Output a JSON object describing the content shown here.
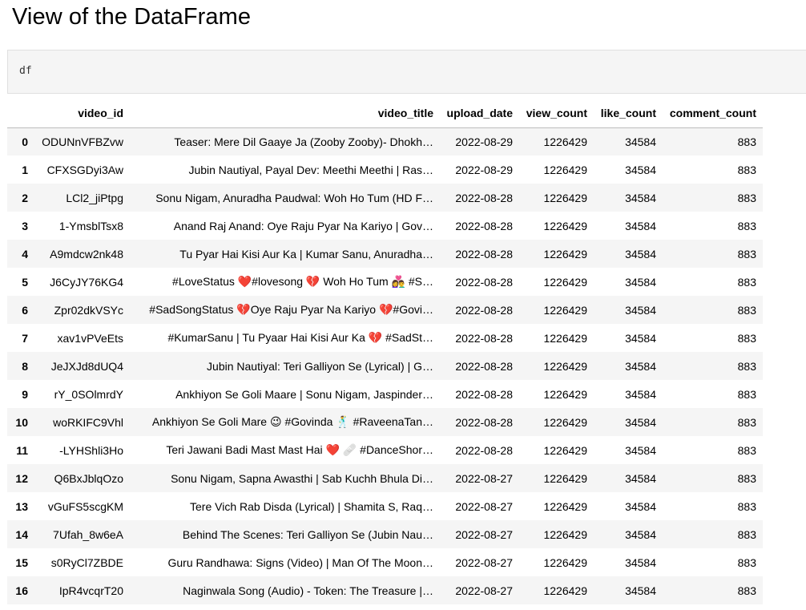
{
  "heading": "View of the DataFrame",
  "code": "df",
  "columns": [
    "",
    "video_id",
    "video_title",
    "upload_date",
    "view_count",
    "like_count",
    "comment_count"
  ],
  "rows": [
    {
      "idx": "0",
      "video_id": "ODUNnVFBZvw",
      "video_title": "Teaser: Mere Dil Gaaye Ja (Zooby Zooby)- Dhokh…",
      "upload_date": "2022-08-29",
      "view_count": "1226429",
      "like_count": "34584",
      "comment_count": "883"
    },
    {
      "idx": "1",
      "video_id": "CFXSGDyi3Aw",
      "video_title": "Jubin Nautiyal, Payal Dev: Meethi Meethi | Ras…",
      "upload_date": "2022-08-29",
      "view_count": "1226429",
      "like_count": "34584",
      "comment_count": "883"
    },
    {
      "idx": "2",
      "video_id": "LCl2_jiPtpg",
      "video_title": "Sonu Nigam, Anuradha Paudwal: Woh Ho Tum (HD F…",
      "upload_date": "2022-08-28",
      "view_count": "1226429",
      "like_count": "34584",
      "comment_count": "883"
    },
    {
      "idx": "3",
      "video_id": "1-YmsblTsx8",
      "video_title": "Anand Raj Anand: Oye Raju Pyar Na Kariyo | Gov…",
      "upload_date": "2022-08-28",
      "view_count": "1226429",
      "like_count": "34584",
      "comment_count": "883"
    },
    {
      "idx": "4",
      "video_id": "A9mdcw2nk48",
      "video_title": "Tu Pyar Hai Kisi Aur Ka | Kumar Sanu, Anuradha…",
      "upload_date": "2022-08-28",
      "view_count": "1226429",
      "like_count": "34584",
      "comment_count": "883"
    },
    {
      "idx": "5",
      "video_id": "J6CyJY76KG4",
      "video_title": "#LoveStatus ❤️#lovesong 💔 Woh Ho Tum 👩‍❤️‍👨 #S…",
      "upload_date": "2022-08-28",
      "view_count": "1226429",
      "like_count": "34584",
      "comment_count": "883"
    },
    {
      "idx": "6",
      "video_id": "Zpr02dkVSYc",
      "video_title": "#SadSongStatus 💔Oye Raju Pyar Na Kariyo 💔#Govi…",
      "upload_date": "2022-08-28",
      "view_count": "1226429",
      "like_count": "34584",
      "comment_count": "883"
    },
    {
      "idx": "7",
      "video_id": "xav1vPVeEts",
      "video_title": "#KumarSanu | Tu Pyaar Hai Kisi Aur Ka 💔 #SadSt…",
      "upload_date": "2022-08-28",
      "view_count": "1226429",
      "like_count": "34584",
      "comment_count": "883"
    },
    {
      "idx": "8",
      "video_id": "JeJXJd8dUQ4",
      "video_title": "Jubin Nautiyal: Teri Galliyon Se (Lyrical) | G…",
      "upload_date": "2022-08-28",
      "view_count": "1226429",
      "like_count": "34584",
      "comment_count": "883"
    },
    {
      "idx": "9",
      "video_id": "rY_0SOlmrdY",
      "video_title": "Ankhiyon Se Goli Maare | Sonu Nigam, Jaspinder…",
      "upload_date": "2022-08-28",
      "view_count": "1226429",
      "like_count": "34584",
      "comment_count": "883"
    },
    {
      "idx": "10",
      "video_id": "woRKIFC9Vhl",
      "video_title": "Ankhiyon Se Goli Mare 😉 #Govinda 🕺 #RaveenaTan…",
      "upload_date": "2022-08-28",
      "view_count": "1226429",
      "like_count": "34584",
      "comment_count": "883"
    },
    {
      "idx": "11",
      "video_id": "-LYHShli3Ho",
      "video_title": "Teri Jawani Badi Mast Mast Hai ❤️ 🩹 #DanceShor…",
      "upload_date": "2022-08-28",
      "view_count": "1226429",
      "like_count": "34584",
      "comment_count": "883"
    },
    {
      "idx": "12",
      "video_id": "Q6BxJblqOzo",
      "video_title": "Sonu Nigam, Sapna Awasthi | Sab Kuchh Bhula Di…",
      "upload_date": "2022-08-27",
      "view_count": "1226429",
      "like_count": "34584",
      "comment_count": "883"
    },
    {
      "idx": "13",
      "video_id": "vGuFS5scgKM",
      "video_title": "Tere Vich Rab Disda (Lyrical) | Shamita S, Raq…",
      "upload_date": "2022-08-27",
      "view_count": "1226429",
      "like_count": "34584",
      "comment_count": "883"
    },
    {
      "idx": "14",
      "video_id": "7Ufah_8w6eA",
      "video_title": "Behind The Scenes: Teri Galliyon Se (Jubin Nau…",
      "upload_date": "2022-08-27",
      "view_count": "1226429",
      "like_count": "34584",
      "comment_count": "883"
    },
    {
      "idx": "15",
      "video_id": "s0RyCl7ZBDE",
      "video_title": "Guru Randhawa: Signs (Video) | Man Of The Moon…",
      "upload_date": "2022-08-27",
      "view_count": "1226429",
      "like_count": "34584",
      "comment_count": "883"
    },
    {
      "idx": "16",
      "video_id": "IpR4vcqrT20",
      "video_title": "Naginwala Song (Audio) - Token: The Treasure |…",
      "upload_date": "2022-08-27",
      "view_count": "1226429",
      "like_count": "34584",
      "comment_count": "883"
    }
  ]
}
